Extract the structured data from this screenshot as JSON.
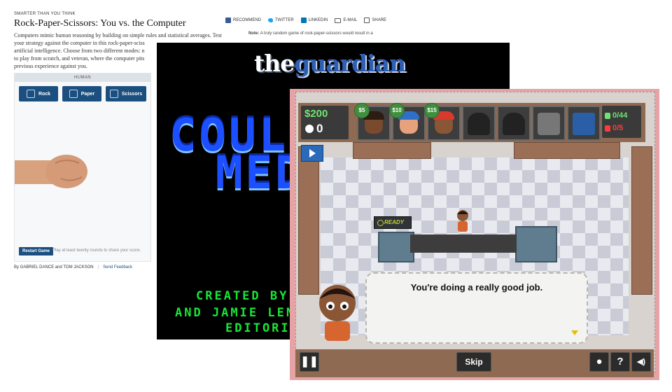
{
  "nyt": {
    "kicker": "SMARTER THAN YOU THINK",
    "title": "Rock-Paper-Scissors: You vs. the Computer",
    "body_lines": [
      "Computers mimic human reasoning by building on simple rules and statistical averages. Test",
      "your strategy against the computer in this rock-paper-sciss",
      "artificial intelligence. Choose from two different modes: n",
      "to play from scratch, and veteran, where the computer pits",
      "previous experience against you."
    ],
    "share": {
      "recommend": "RECOMMEND",
      "twitter": "TWITTER",
      "linkedin": "LINKEDIN",
      "email": "E-MAIL",
      "share": "SHARE"
    },
    "note_label": "Note:",
    "note_text": "A truly random game of rock-paper-scissors would result in a",
    "human_label": "HUMAN",
    "buttons": {
      "rock": "Rock",
      "paper": "Paper",
      "scissors": "Scissors"
    },
    "restart_label": "Restart Game",
    "restart_note": "Play at least twenty rounds to share your score.",
    "byline": "By GABRIEL DANCE and TOM JACKSON",
    "feedback": "Send Feedback",
    "colors": {
      "button": "#1b4f80"
    }
  },
  "guardian": {
    "logo_the": "the",
    "logo_guardian": "guardian",
    "big_line1": "COULD",
    "big_line2": "MED",
    "credit1": "CREATED BY",
    "credit2": "AND JAMIE LEN",
    "credit3": "EDITORI",
    "colors": {
      "big_text": "#1c4fff",
      "credits": "#19e635"
    }
  },
  "game": {
    "money": "$200",
    "count": "0",
    "prices": [
      "$5",
      "$10",
      "$15"
    ],
    "good_count": "0/44",
    "bad_count": "0/5",
    "ready_label": "READY",
    "speech": "You're doing a really good job.",
    "skip_label": "Skip",
    "help_label": "?",
    "icons": [
      "pause-icon",
      "user-icon",
      "help-icon",
      "sound-icon",
      "play-icon"
    ],
    "colors": {
      "money": "#6fe46f",
      "good": "#6fe46f",
      "bad": "#ff3b3b"
    }
  }
}
